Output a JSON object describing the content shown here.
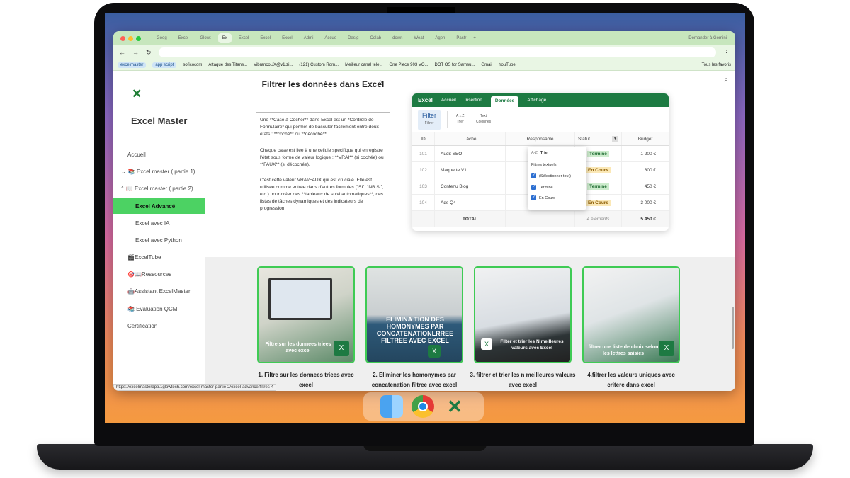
{
  "browser": {
    "tabs": [
      "Goog",
      "Excel",
      "Glowt",
      "Ex",
      "Excel",
      "Excel",
      "Excel",
      "Admi",
      "Accue",
      "Desig",
      "Colab",
      "down",
      "Weat",
      "Agen",
      "Pastr"
    ],
    "gemini_label": "Demander à Gemini",
    "bookmarks": [
      "excelmaster",
      "app script",
      "soficocom",
      "Attaque des Titans...",
      "VibrancoUX@v1.zi...",
      "(121) Custom Rom...",
      "Meilleur canal tele...",
      "One Piece 903 VO...",
      "DOT OS for Samsu...",
      "Gmail",
      "YouTube",
      "Tous les favoris"
    ],
    "status_url": "https://excelmasterapp.1glowtech.com/excel-master-partie-2/excel-advance/filtres-4"
  },
  "sidebar": {
    "brand": "Excel Master",
    "items": [
      {
        "label": "Accueil"
      },
      {
        "label": "📚 Excel master ( partie 1)",
        "chevron": "⌄"
      },
      {
        "label": "📖 Excel master ( partie 2)",
        "chevron": "^"
      },
      {
        "label": "Excel Advancé"
      },
      {
        "label": "Excel avec IA"
      },
      {
        "label": "Excel avec Python"
      },
      {
        "label": "🎬ExcelTube"
      },
      {
        "label": "🎯📖Ressources"
      },
      {
        "label": "🤖Assistant ExcelMaster"
      },
      {
        "label": "📚 Evaluation QCM"
      },
      {
        "label": "Certification"
      }
    ]
  },
  "article": {
    "title": "Filtrer les données dans Excel",
    "p1": "Une **Case à Cocher** dans Excel est un *Contrôle de Formulaire* qui permet de basculer facilement entre deux états : **coché** ou **décoché**.",
    "p2": "Chaque case est liée à une cellule spécifique qui enregistre l'état sous forme de valeur logique : **VRAI** (si cochée) ou **FAUX** (si décochée).",
    "p3": "C'est cette valeur VRAI/FAUX qui est cruciale. Elle est utilisée comme entrée dans d'autres formules (`SI`, `NB.SI`, etc.) pour créer des **tableaux de suivi automatiques**, des listes de tâches dynamiques et des indicateurs de progression."
  },
  "excel": {
    "brand": "Excel",
    "tabs": [
      "Accueil",
      "Insertion",
      "Données",
      "Affichage"
    ],
    "filter": "Filter",
    "filter_sub": "Filtrer",
    "sort_icon": "A→Z",
    "sort_label": "Trier",
    "text_label": "Text",
    "cols_label": "Colonnes",
    "headers": [
      "ID",
      "Tâche",
      "Responsable",
      "Statut",
      "Budget"
    ],
    "rows": [
      {
        "id": "101",
        "task": "Audit SEO",
        "status": "Terminé",
        "budget": "1 200 €"
      },
      {
        "id": "102",
        "task": "Maquette V1",
        "status": "En Cours",
        "budget": "800 €"
      },
      {
        "id": "103",
        "task": "Contenu Blog",
        "status": "Terminé",
        "budget": "450 €"
      },
      {
        "id": "104",
        "task": "Ads Q4",
        "status": "En Cours",
        "budget": "3 000 €"
      }
    ],
    "total_label": "TOTAL",
    "total_count": "4 éléments",
    "total_budget": "5 450 €",
    "dropdown": {
      "sort_icon": "A-Z",
      "sort": "Trier",
      "section": "Filtres textuels",
      "options": [
        "(Sélectionner tout)",
        "Terminé",
        "En Cours"
      ]
    }
  },
  "cards": [
    {
      "overlay": "Filtre sur les donnees triees avec excel",
      "caption": "1. Filtre sur les donnees triees avec excel"
    },
    {
      "overlay": "ELIMINA TION DES HOMONYMES PAR CONCATENATIONLRREE FILTREE AVEC EXCEL",
      "caption": "2. Eliminer les homonymes par concatenation filtree avec excel"
    },
    {
      "overlay": "Filter et trier les N meilleures valeurs avec Excel",
      "caption": "3. filtrer et trier les n meilleures valeurs avec excel"
    },
    {
      "overlay": "filtrer une liste de choix selon les lettres saisies",
      "caption": "4.filtrer les valeurs uniques avec critere dans excel"
    }
  ],
  "colors": {
    "brand_green": "#1d7a42",
    "accent_green": "#4cd263",
    "excel_header": "#1d7a42"
  },
  "icons": [
    "search-icon",
    "excel-logo-icon",
    "info-icon",
    "finder-icon",
    "chrome-icon",
    "excel-dock-icon"
  ]
}
